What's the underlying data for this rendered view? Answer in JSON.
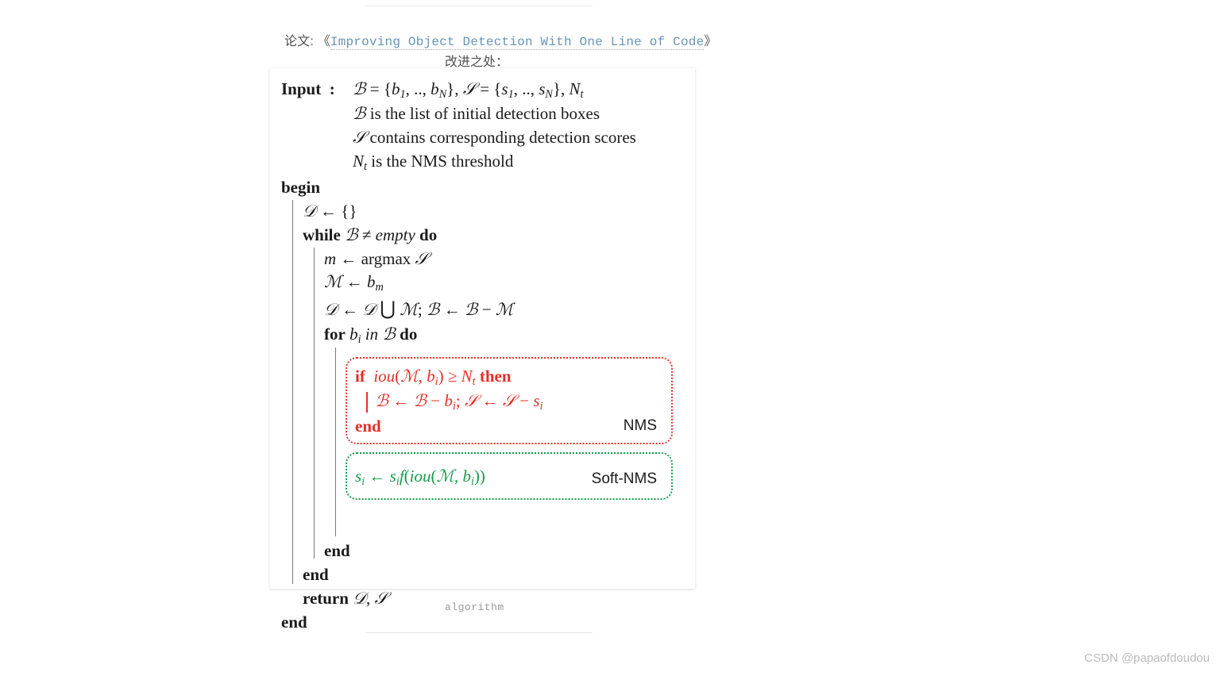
{
  "intro": {
    "prefix": "论文: 《",
    "link_text": "Improving Object Detection With One Line of Code",
    "suffix": "》"
  },
  "subtitle": "改进之处：",
  "algorithm": {
    "input_label": "Input",
    "input_colon": ":",
    "input_line": "ℬ = {b₁, .., b_N}, 𝒮 = {s₁, .., s_N}, N_t",
    "input_desc1": "ℬ is the list of initial detection boxes",
    "input_desc2": "𝒮 contains corresponding detection scores",
    "input_desc3": "N_t is the NMS threshold",
    "begin": "begin",
    "d_init": "𝒟 ← {}",
    "while_line": "while ℬ ≠ empty do",
    "m_line": "m ← argmax 𝒮",
    "M_line": "ℳ ← b_m",
    "union_line": "𝒟 ← 𝒟 ⋃ ℳ; ℬ ← ℬ − ℳ",
    "for_line": "for b_i in ℬ do",
    "nms_if": "if  iou(ℳ, b_i) ≥ N_t then",
    "nms_body": "ℬ ← ℬ − b_i; 𝒮 ← 𝒮 − s_i",
    "nms_end": "end",
    "nms_label": "NMS",
    "soft_body": "s_i ← s_i f(iou(ℳ, b_i))",
    "soft_label": "Soft-NMS",
    "end_for": "end",
    "end_while": "end",
    "return_line": "return 𝒟, 𝒮",
    "end": "end"
  },
  "caption": "algorithm",
  "watermark": "CSDN @papaofdoudou"
}
